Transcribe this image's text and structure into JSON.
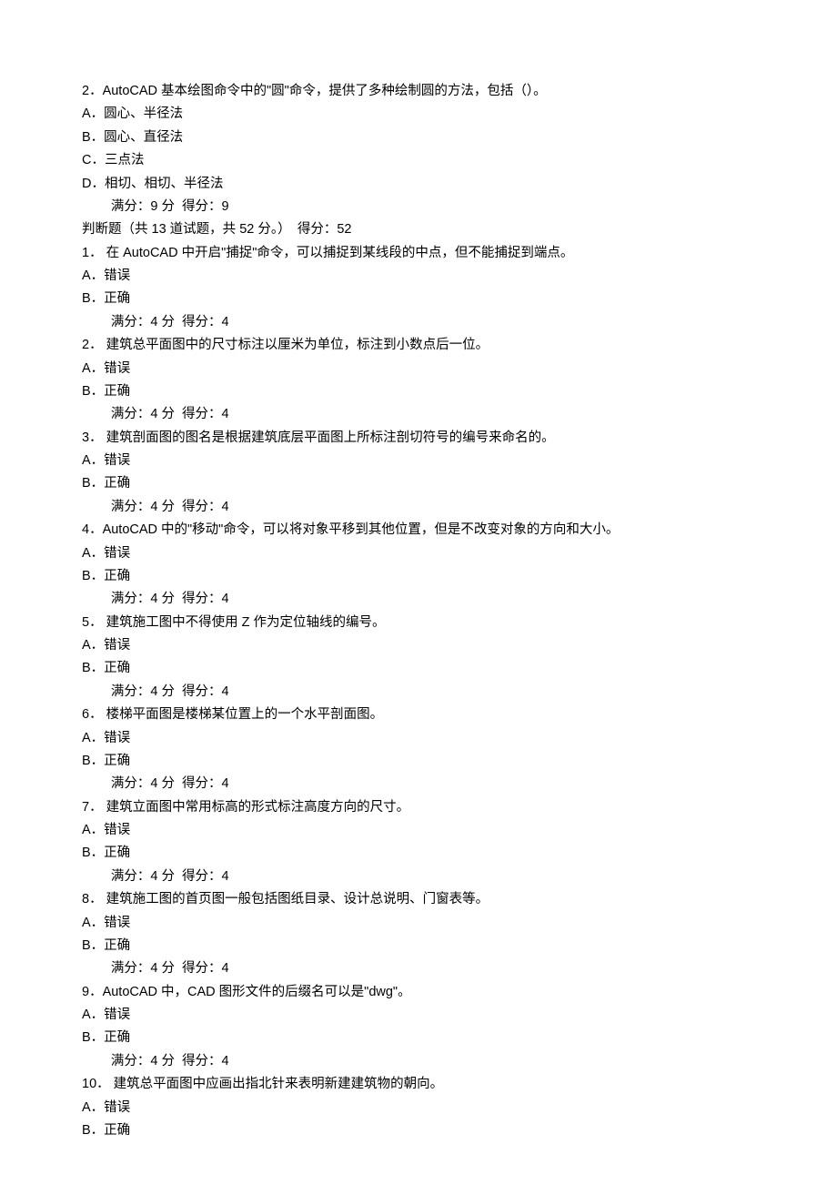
{
  "mcq2": {
    "stem": "2．AutoCAD 基本绘图命令中的\"圆\"命令，提供了多种绘制圆的方法，包括（）。",
    "optA": "A．圆心、半径法",
    "optB": "B．圆心、直径法",
    "optC": "C．三点法",
    "optD": "D．相切、相切、半径法",
    "scoreLine": "满分：9 分  得分：9"
  },
  "judgeHeader": "判断题（共 13 道试题，共 52 分。）　得分：52",
  "judge": [
    {
      "stem": "1． 在 AutoCAD 中开启\"捕捉\"命令，可以捕捉到某线段的中点，但不能捕捉到端点。",
      "optA": "A．错误",
      "optB": "B．正确",
      "scoreLine": "满分：4 分  得分：4"
    },
    {
      "stem": "2． 建筑总平面图中的尺寸标注以厘米为单位，标注到小数点后一位。",
      "optA": "A．错误",
      "optB": "B．正确",
      "scoreLine": "满分：4 分  得分：4"
    },
    {
      "stem": "3． 建筑剖面图的图名是根据建筑底层平面图上所标注剖切符号的编号来命名的。",
      "optA": "A．错误",
      "optB": "B．正确",
      "scoreLine": "满分：4 分  得分：4"
    },
    {
      "stem": "4．AutoCAD 中的\"移动\"命令，可以将对象平移到其他位置，但是不改变对象的方向和大小。",
      "optA": "A．错误",
      "optB": "B．正确",
      "scoreLine": "满分：4 分  得分：4"
    },
    {
      "stem": "5． 建筑施工图中不得使用 Z 作为定位轴线的编号。",
      "optA": "A．错误",
      "optB": "B．正确",
      "scoreLine": "满分：4 分  得分：4"
    },
    {
      "stem": "6． 楼梯平面图是楼梯某位置上的一个水平剖面图。",
      "optA": "A．错误",
      "optB": "B．正确",
      "scoreLine": "满分：4 分  得分：4"
    },
    {
      "stem": "7． 建筑立面图中常用标高的形式标注高度方向的尺寸。",
      "optA": "A．错误",
      "optB": "B．正确",
      "scoreLine": "满分：4 分  得分：4"
    },
    {
      "stem": "8． 建筑施工图的首页图一般包括图纸目录、设计总说明、门窗表等。",
      "optA": "A．错误",
      "optB": "B．正确",
      "scoreLine": "满分：4 分  得分：4"
    },
    {
      "stem": "9．AutoCAD 中，CAD 图形文件的后缀名可以是\"dwg\"。",
      "optA": "A．错误",
      "optB": "B．正确",
      "scoreLine": "满分：4 分  得分：4"
    },
    {
      "stem": "10． 建筑总平面图中应画出指北针来表明新建建筑物的朝向。",
      "optA": "A．错误",
      "optB": "B．正确",
      "scoreLine": ""
    }
  ]
}
